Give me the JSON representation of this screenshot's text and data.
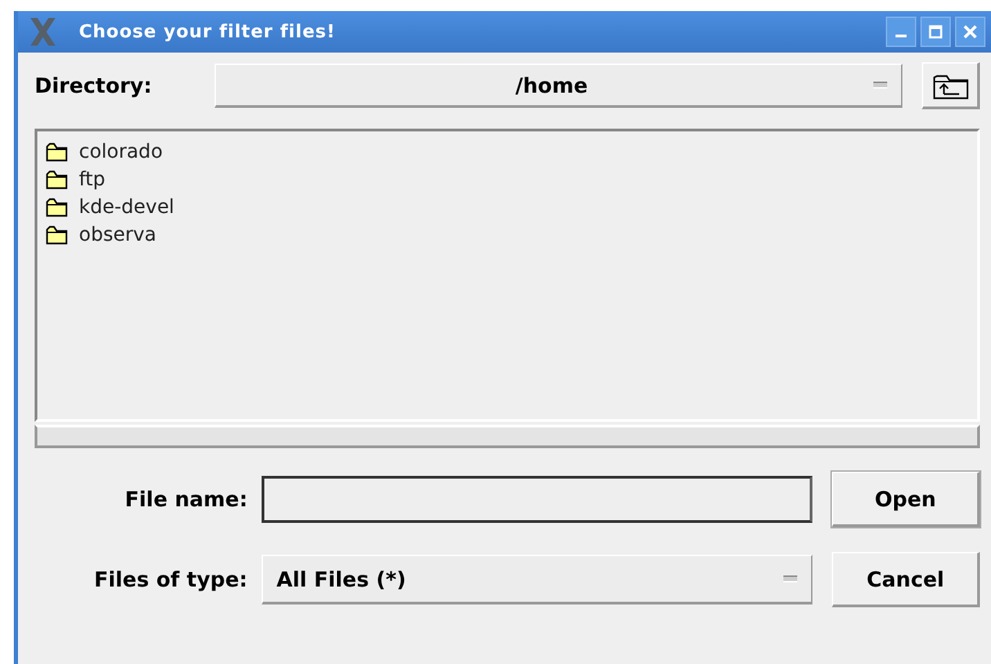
{
  "window": {
    "title": "Choose your filter files!"
  },
  "directory": {
    "label": "Directory:",
    "value": "/home"
  },
  "files": [
    {
      "name": "colorado",
      "selected": false
    },
    {
      "name": "ftp",
      "selected": false
    },
    {
      "name": "kde-devel",
      "selected": false
    },
    {
      "name": "observa",
      "selected": false
    }
  ],
  "file_name": {
    "label": "File name:"
  },
  "file_type": {
    "label": "Files of type:",
    "value": "All Files (*)"
  },
  "buttons": [
    "Open",
    "Cancel"
  ]
}
